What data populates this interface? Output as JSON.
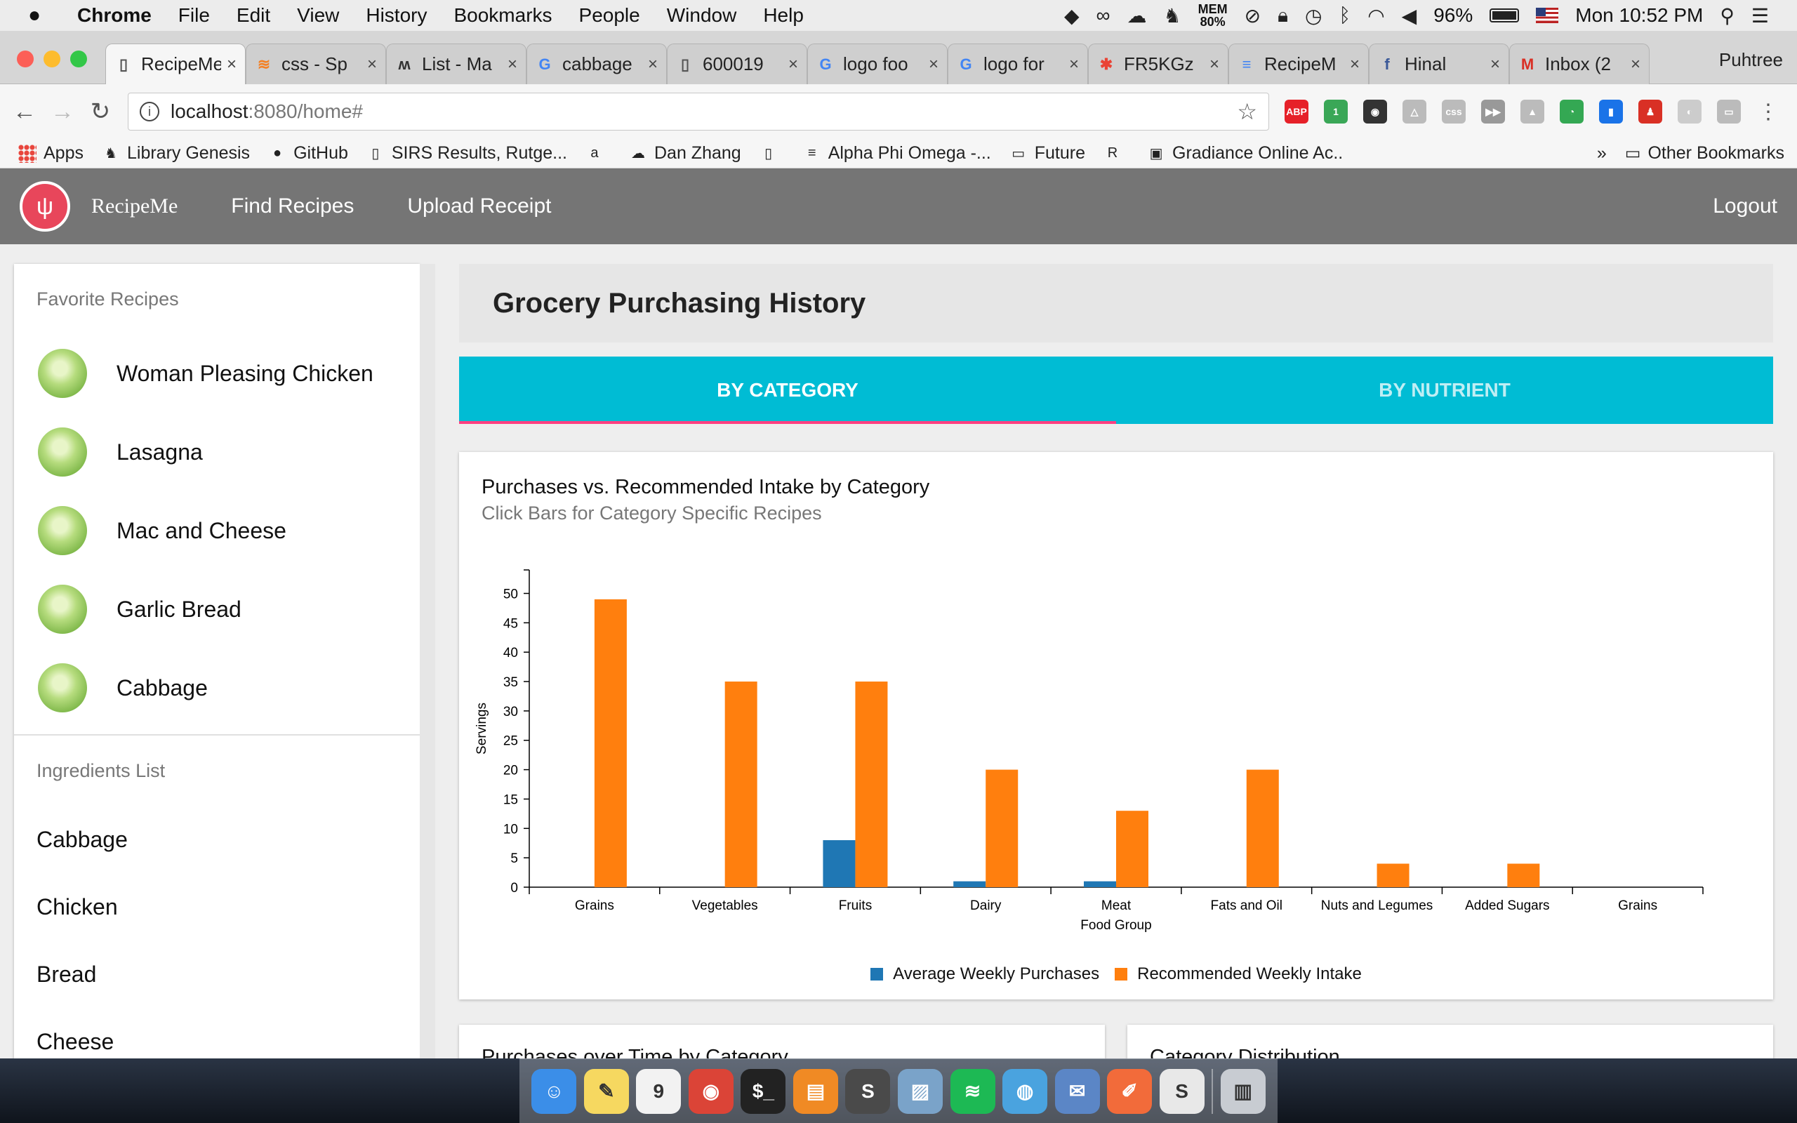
{
  "menubar": {
    "app": "Chrome",
    "items": [
      "File",
      "Edit",
      "View",
      "History",
      "Bookmarks",
      "People",
      "Window",
      "Help"
    ],
    "mem_label": "MEM",
    "mem_value": "80%",
    "battery": "96%",
    "clock": "Mon 10:52 PM"
  },
  "tabs": [
    {
      "title": "RecipeMe",
      "fav": "▯",
      "fav_color": "#555555"
    },
    {
      "title": "css - Sp",
      "fav": "≋",
      "fav_color": "#f48024"
    },
    {
      "title": "List - Ma",
      "fav": "ʍ",
      "fav_color": "#333333"
    },
    {
      "title": "cabbage",
      "fav": "G",
      "fav_color": "#4285f4"
    },
    {
      "title": "600019",
      "fav": "▯",
      "fav_color": "#555555"
    },
    {
      "title": "logo foo",
      "fav": "G",
      "fav_color": "#4285f4"
    },
    {
      "title": "logo for",
      "fav": "G",
      "fav_color": "#4285f4"
    },
    {
      "title": "FR5KGz",
      "fav": "✱",
      "fav_color": "#ea4335"
    },
    {
      "title": "RecipeM",
      "fav": "≡",
      "fav_color": "#4285f4"
    },
    {
      "title": "Hinal",
      "fav": "f",
      "fav_color": "#3b5998"
    },
    {
      "title": "Inbox (2",
      "fav": "M",
      "fav_color": "#d93025"
    }
  ],
  "profile": "Puhtree",
  "omnibox": {
    "host": "localhost",
    "path": ":8080/home#"
  },
  "extensions": [
    {
      "label": "ABP",
      "color": "#e62129"
    },
    {
      "label": "1",
      "color": "#3aa757"
    },
    {
      "label": "◉",
      "color": "#333333"
    },
    {
      "label": "△",
      "color": "#bbbbbb"
    },
    {
      "label": "css",
      "color": "#bbbbbb"
    },
    {
      "label": "▶▶",
      "color": "#999999"
    },
    {
      "label": "▲",
      "color": "#bbbbbb"
    },
    {
      "label": "◔",
      "color": "#34a853"
    },
    {
      "label": "▮",
      "color": "#1a73e8"
    },
    {
      "label": "♟",
      "color": "#d93025"
    },
    {
      "label": "◐",
      "color": "#cccccc"
    },
    {
      "label": "▭",
      "color": "#bbbbbb"
    }
  ],
  "bookmarks": [
    {
      "label": "Apps",
      "icon": "apps"
    },
    {
      "label": "Library Genesis",
      "icon": "♞"
    },
    {
      "label": "GitHub",
      "icon": "●"
    },
    {
      "label": "SIRS Results, Rutge...",
      "icon": "▯"
    },
    {
      "label": "",
      "icon": "a"
    },
    {
      "label": "Dan Zhang",
      "icon": "☁"
    },
    {
      "label": "",
      "icon": "▯"
    },
    {
      "label": "Alpha Phi Omega -...",
      "icon": "≡"
    },
    {
      "label": "Future",
      "icon": "▭"
    },
    {
      "label": "",
      "icon": "R"
    },
    {
      "label": "Gradiance Online Ac..",
      "icon": "▣"
    }
  ],
  "bookmarks_overflow": "»",
  "other_bookmarks": "Other Bookmarks",
  "app": {
    "brand": "RecipeMe",
    "nav": [
      "Find Recipes",
      "Upload Receipt"
    ],
    "logout": "Logout"
  },
  "sidebar": {
    "favorites_header": "Favorite Recipes",
    "favorites": [
      "Woman Pleasing Chicken",
      "Lasagna",
      "Mac and Cheese",
      "Garlic Bread",
      "Cabbage"
    ],
    "ingredients_header": "Ingredients List",
    "ingredients": [
      "Cabbage",
      "Chicken",
      "Bread",
      "Cheese"
    ]
  },
  "main": {
    "title": "Grocery Purchasing History",
    "tabs": [
      "BY CATEGORY",
      "BY NUTRIENT"
    ],
    "card_title": "Purchases vs. Recommended Intake by Category",
    "card_subtitle": "Click Bars for Category Specific Recipes",
    "bottom_cards": [
      "Purchases over Time by Category",
      "Category Distribution"
    ]
  },
  "chart_data": {
    "type": "bar",
    "title": "Purchases vs. Recommended Intake by Category",
    "subtitle": "Click Bars for Category Specific Recipes",
    "xlabel": "Food Group",
    "ylabel": "Servings",
    "ylim": [
      0,
      54
    ],
    "yticks": [
      0,
      5,
      10,
      15,
      20,
      25,
      30,
      35,
      40,
      45,
      50
    ],
    "categories": [
      "Grains",
      "Vegetables",
      "Fruits",
      "Dairy",
      "Meat",
      "Fats and Oil",
      "Nuts and Legumes",
      "Added Sugars",
      "Grains"
    ],
    "series": [
      {
        "name": "Average Weekly Purchases",
        "color": "#1f77b4",
        "values": [
          0,
          0,
          8,
          1,
          1,
          0,
          0,
          0,
          0
        ]
      },
      {
        "name": "Recommended Weekly Intake",
        "color": "#ff7f0e",
        "values": [
          49,
          35,
          35,
          20,
          13,
          20,
          4,
          4,
          0
        ]
      }
    ],
    "legend": "bottom-center",
    "grid": false
  },
  "dock": [
    {
      "name": "finder",
      "glyph": "☺",
      "color": "#3b8ee8"
    },
    {
      "name": "notes",
      "glyph": "✎",
      "color": "#f6d860"
    },
    {
      "name": "calendar",
      "glyph": "9",
      "color": "#f2f2f2"
    },
    {
      "name": "chrome",
      "glyph": "◉",
      "color": "#db4437"
    },
    {
      "name": "terminal",
      "glyph": "$_",
      "color": "#222222"
    },
    {
      "name": "ibooks",
      "glyph": "▤",
      "color": "#f08a24"
    },
    {
      "name": "sublime",
      "glyph": "S",
      "color": "#4a4a4a"
    },
    {
      "name": "preview",
      "glyph": "▨",
      "color": "#7aa3c9"
    },
    {
      "name": "spotify",
      "glyph": "≋",
      "color": "#1db954"
    },
    {
      "name": "sequel",
      "glyph": "◍",
      "color": "#4aa3df"
    },
    {
      "name": "mail",
      "glyph": "✉",
      "color": "#5b86c6"
    },
    {
      "name": "pencil",
      "glyph": "✐",
      "color": "#f26b3a"
    },
    {
      "name": "slack",
      "glyph": "S",
      "color": "#e8e8e8"
    },
    {
      "name": "trash",
      "glyph": "▥",
      "color": "#c8ccd2"
    }
  ]
}
